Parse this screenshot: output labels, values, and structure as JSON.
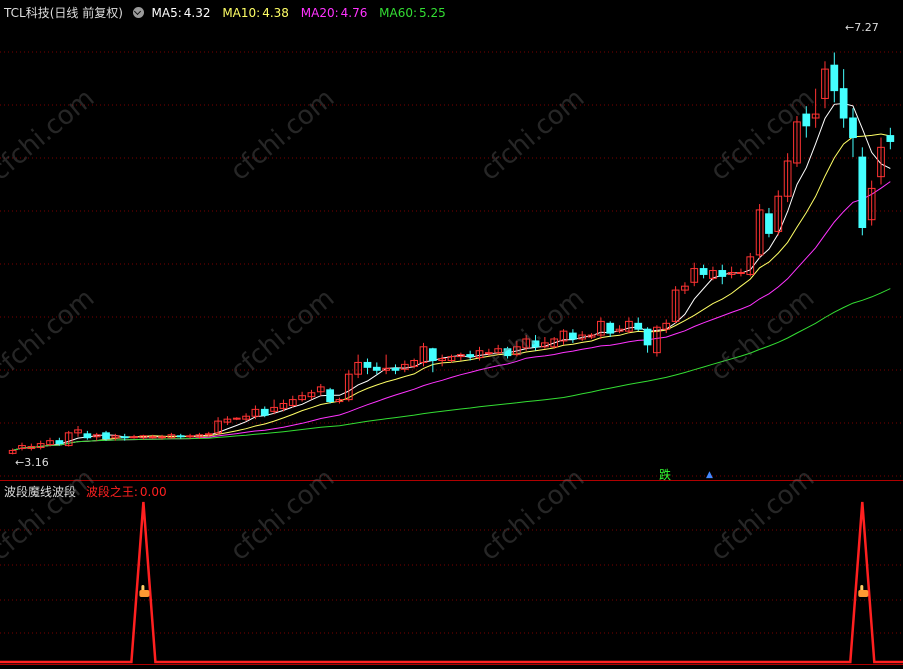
{
  "header": {
    "stock_title": "TCL科技(日线 前复权)",
    "ma5": {
      "label": "MA5:",
      "value": "4.32",
      "color": "#ffffff"
    },
    "ma10": {
      "label": "MA10:",
      "value": "4.38",
      "color": "#ffff66"
    },
    "ma20": {
      "label": "MA20:",
      "value": "4.76",
      "color": "#ff33ff"
    },
    "ma60": {
      "label": "MA60:",
      "value": "5.25",
      "color": "#33dd33"
    }
  },
  "indicator": {
    "name": "波段魔线波段",
    "series_label": "波段之王:",
    "series_value": "0.00",
    "color": "#ff2020"
  },
  "annotations": {
    "high_label": "7.27",
    "low_label": "3.16",
    "signal_label": "跌",
    "hand_icon": "hand-pointer-icon"
  },
  "watermark": "cfchi.com",
  "colors": {
    "up": "#ff3333",
    "down": "#44ffff",
    "grid": "#7a0000",
    "bg": "#000000"
  },
  "chart_data": {
    "type": "candlestick",
    "ylim": [
      3.0,
      7.5
    ],
    "highest": 7.27,
    "lowest": 3.16,
    "candles": [
      [
        3.17,
        3.2,
        3.16,
        3.22
      ],
      [
        3.22,
        3.25,
        3.2,
        3.28
      ],
      [
        3.22,
        3.24,
        3.2,
        3.27
      ],
      [
        3.23,
        3.27,
        3.21,
        3.3
      ],
      [
        3.26,
        3.3,
        3.24,
        3.33
      ],
      [
        3.3,
        3.27,
        3.25,
        3.33
      ],
      [
        3.25,
        3.38,
        3.24,
        3.4
      ],
      [
        3.38,
        3.41,
        3.34,
        3.45
      ],
      [
        3.37,
        3.33,
        3.31,
        3.4
      ],
      [
        3.34,
        3.36,
        3.3,
        3.38
      ],
      [
        3.38,
        3.32,
        3.3,
        3.4
      ],
      [
        3.33,
        3.35,
        3.3,
        3.37
      ],
      [
        3.34,
        3.33,
        3.3,
        3.37
      ],
      [
        3.33,
        3.34,
        3.32,
        3.36
      ],
      [
        3.33,
        3.35,
        3.31,
        3.36
      ],
      [
        3.34,
        3.34,
        3.32,
        3.36
      ],
      [
        3.33,
        3.34,
        3.31,
        3.36
      ],
      [
        3.33,
        3.36,
        3.32,
        3.38
      ],
      [
        3.35,
        3.34,
        3.32,
        3.37
      ],
      [
        3.34,
        3.35,
        3.32,
        3.37
      ],
      [
        3.34,
        3.36,
        3.32,
        3.38
      ],
      [
        3.36,
        3.37,
        3.34,
        3.39
      ],
      [
        3.38,
        3.5,
        3.36,
        3.54
      ],
      [
        3.49,
        3.52,
        3.46,
        3.55
      ],
      [
        3.53,
        3.53,
        3.51,
        3.54
      ],
      [
        3.52,
        3.55,
        3.5,
        3.58
      ],
      [
        3.55,
        3.62,
        3.52,
        3.66
      ],
      [
        3.62,
        3.56,
        3.54,
        3.65
      ],
      [
        3.6,
        3.64,
        3.57,
        3.72
      ],
      [
        3.63,
        3.68,
        3.6,
        3.72
      ],
      [
        3.66,
        3.72,
        3.64,
        3.76
      ],
      [
        3.72,
        3.76,
        3.7,
        3.8
      ],
      [
        3.75,
        3.79,
        3.72,
        3.82
      ],
      [
        3.8,
        3.85,
        3.76,
        3.88
      ],
      [
        3.82,
        3.7,
        3.68,
        3.84
      ],
      [
        3.7,
        3.72,
        3.68,
        3.74
      ],
      [
        3.72,
        3.98,
        3.7,
        4.02
      ],
      [
        3.98,
        4.1,
        3.94,
        4.18
      ],
      [
        4.1,
        4.05,
        3.98,
        4.14
      ],
      [
        4.05,
        4.02,
        3.98,
        4.1
      ],
      [
        4.02,
        4.04,
        3.98,
        4.18
      ],
      [
        4.04,
        4.02,
        3.98,
        4.08
      ],
      [
        4.03,
        4.08,
        4.0,
        4.12
      ],
      [
        4.06,
        4.12,
        4.04,
        4.14
      ],
      [
        4.1,
        4.26,
        4.06,
        4.3
      ],
      [
        4.24,
        4.12,
        4.0,
        4.25
      ],
      [
        4.12,
        4.14,
        4.06,
        4.18
      ],
      [
        4.12,
        4.16,
        4.1,
        4.18
      ],
      [
        4.16,
        4.18,
        4.12,
        4.2
      ],
      [
        4.18,
        4.16,
        4.12,
        4.22
      ],
      [
        4.15,
        4.22,
        4.12,
        4.26
      ],
      [
        4.2,
        4.2,
        4.17,
        4.24
      ],
      [
        4.2,
        4.24,
        4.18,
        4.28
      ],
      [
        4.24,
        4.17,
        4.14,
        4.26
      ],
      [
        4.18,
        4.26,
        4.16,
        4.32
      ],
      [
        4.25,
        4.34,
        4.22,
        4.38
      ],
      [
        4.32,
        4.26,
        4.22,
        4.38
      ],
      [
        4.26,
        4.3,
        4.24,
        4.36
      ],
      [
        4.26,
        4.34,
        4.24,
        4.36
      ],
      [
        4.32,
        4.42,
        4.28,
        4.44
      ],
      [
        4.4,
        4.34,
        4.3,
        4.44
      ],
      [
        4.34,
        4.38,
        4.32,
        4.42
      ],
      [
        4.36,
        4.38,
        4.34,
        4.4
      ],
      [
        4.38,
        4.52,
        4.34,
        4.56
      ],
      [
        4.5,
        4.4,
        4.36,
        4.52
      ],
      [
        4.42,
        4.44,
        4.4,
        4.48
      ],
      [
        4.42,
        4.52,
        4.4,
        4.56
      ],
      [
        4.5,
        4.44,
        4.42,
        4.56
      ],
      [
        4.44,
        4.28,
        4.2,
        4.46
      ],
      [
        4.2,
        4.46,
        4.16,
        4.48
      ],
      [
        4.44,
        4.5,
        4.4,
        4.54
      ],
      [
        4.52,
        4.84,
        4.5,
        4.88
      ],
      [
        4.84,
        4.88,
        4.8,
        4.92
      ],
      [
        4.92,
        5.06,
        4.88,
        5.12
      ],
      [
        5.06,
        5.0,
        4.96,
        5.1
      ],
      [
        4.96,
        5.04,
        4.94,
        5.08
      ],
      [
        5.04,
        4.98,
        4.9,
        5.1
      ],
      [
        5.0,
        5.02,
        4.96,
        5.08
      ],
      [
        5.02,
        5.02,
        4.98,
        5.06
      ],
      [
        5.0,
        5.18,
        4.98,
        5.22
      ],
      [
        5.2,
        5.66,
        5.16,
        5.72
      ],
      [
        5.62,
        5.42,
        5.38,
        5.68
      ],
      [
        5.44,
        5.8,
        5.4,
        5.86
      ],
      [
        5.8,
        6.16,
        5.74,
        6.24
      ],
      [
        6.14,
        6.56,
        6.1,
        6.62
      ],
      [
        6.64,
        6.52,
        6.4,
        6.72
      ],
      [
        6.6,
        6.64,
        6.5,
        6.9
      ],
      [
        6.8,
        7.1,
        6.7,
        7.18
      ],
      [
        7.14,
        6.88,
        6.76,
        7.27
      ],
      [
        6.9,
        6.6,
        6.5,
        7.1
      ],
      [
        6.6,
        6.4,
        6.2,
        6.7
      ],
      [
        6.2,
        5.48,
        5.4,
        6.3
      ],
      [
        5.56,
        5.88,
        5.5,
        5.96
      ],
      [
        6.0,
        6.3,
        5.92,
        6.4
      ],
      [
        6.42,
        6.36,
        6.28,
        6.5
      ]
    ],
    "indicator_series": {
      "name": "波段之王",
      "peaks_at_candle": [
        14,
        91
      ],
      "peak_value": 1.0
    }
  }
}
